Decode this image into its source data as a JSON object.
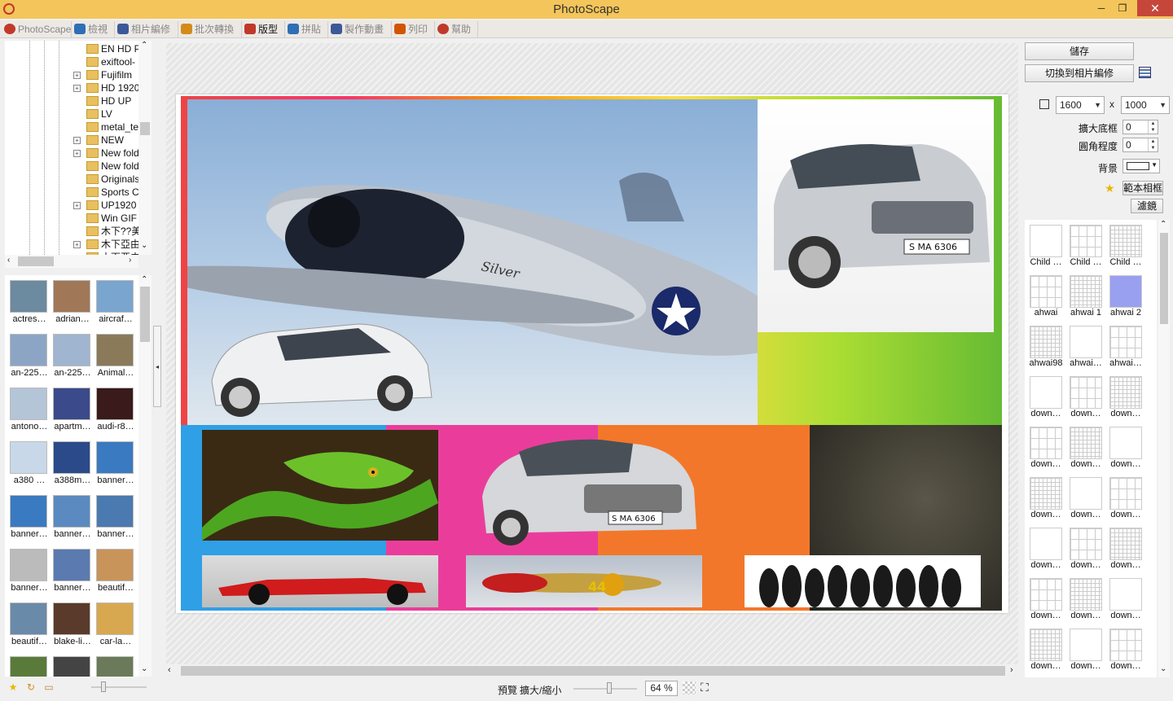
{
  "window": {
    "title": "PhotoScape",
    "close_glyph": "✕",
    "max_glyph": "❐",
    "min_glyph": "─"
  },
  "tabs": [
    {
      "label": "PhotoScape",
      "color": "#c0392b"
    },
    {
      "label": "檢視",
      "color": "#2e6fb5"
    },
    {
      "label": "相片編修",
      "color": "#3b5998"
    },
    {
      "label": "批次轉換",
      "color": "#d48b1a"
    },
    {
      "label": "版型",
      "color": "#c0392b"
    },
    {
      "label": "拼貼",
      "color": "#2e6fb5"
    },
    {
      "label": "製作動畫",
      "color": "#3b5998"
    },
    {
      "label": "列印",
      "color": "#d35400"
    },
    {
      "label": "幫助",
      "color": "#c0392b"
    }
  ],
  "tree": {
    "items": [
      {
        "label": "EN HD P",
        "expander": ""
      },
      {
        "label": "exiftool-",
        "expander": ""
      },
      {
        "label": "Fujifilm",
        "expander": "+"
      },
      {
        "label": "HD 1920",
        "expander": "+"
      },
      {
        "label": "HD UP",
        "expander": ""
      },
      {
        "label": "LV",
        "expander": ""
      },
      {
        "label": "metal_te",
        "expander": ""
      },
      {
        "label": "NEW",
        "expander": "+"
      },
      {
        "label": "New fold",
        "expander": "+"
      },
      {
        "label": "New fold",
        "expander": ""
      },
      {
        "label": "Originals",
        "expander": ""
      },
      {
        "label": "Sports C",
        "expander": ""
      },
      {
        "label": "UP1920",
        "expander": "+"
      },
      {
        "label": "Win GIF",
        "expander": ""
      },
      {
        "label": "木下??美",
        "expander": ""
      },
      {
        "label": "木下亞由",
        "expander": "+"
      },
      {
        "label": "木下亞由",
        "expander": ""
      }
    ]
  },
  "thumbnails": [
    {
      "caption": "actres…",
      "color": "#6c8aa0"
    },
    {
      "caption": "adrian…",
      "color": "#a07858"
    },
    {
      "caption": "aircraf…",
      "color": "#7aa5cf"
    },
    {
      "caption": "an-225…",
      "color": "#8ca5c5"
    },
    {
      "caption": "an-225…",
      "color": "#9fb5d0"
    },
    {
      "caption": "Animal…",
      "color": "#8a7a5a"
    },
    {
      "caption": "antono…",
      "color": "#b5c5d8"
    },
    {
      "caption": "apartm…",
      "color": "#3a4a8a"
    },
    {
      "caption": "audi-r8…",
      "color": "#3a1a1a"
    },
    {
      "caption": "a380 …",
      "color": "#c8d8e8"
    },
    {
      "caption": "a388m…",
      "color": "#2a4a8a"
    },
    {
      "caption": "banner…",
      "color": "#3a7ac0"
    },
    {
      "caption": "banner…",
      "color": "#3a7ac0"
    },
    {
      "caption": "banner…",
      "color": "#5a8ac0"
    },
    {
      "caption": "banner…",
      "color": "#4a7ab0"
    },
    {
      "caption": "banner…",
      "color": "#bbbbbb"
    },
    {
      "caption": "banner…",
      "color": "#5a7ab0"
    },
    {
      "caption": "beautif…",
      "color": "#c8945a"
    },
    {
      "caption": "beautif…",
      "color": "#6a8aaa"
    },
    {
      "caption": "blake-li…",
      "color": "#5a3a2a"
    },
    {
      "caption": "car-la…",
      "color": "#d8a850"
    },
    {
      "caption": "",
      "color": "#5a7a3a"
    },
    {
      "caption": "",
      "color": "#444444"
    },
    {
      "caption": "",
      "color": "#6a7a5a"
    }
  ],
  "right": {
    "save_label": "儲存",
    "switch_label": "切換到相片編修",
    "width": "1600",
    "x_label": "x",
    "height": "1000",
    "expand_border_label": "擴大底框",
    "expand_border_value": "0",
    "round_corner_label": "圓角程度",
    "round_corner_value": "0",
    "bg_label": "背景",
    "template_frame_label": "範本相框",
    "filter_label": "濾鏡"
  },
  "templates": [
    "Child …",
    "Child …",
    "Child …",
    "ahwai",
    "ahwai 1",
    "ahwai 2",
    "ahwai98",
    "ahwai…",
    "ahwai…",
    "down…",
    "down…",
    "down…",
    "down…",
    "down…",
    "down…",
    "down…",
    "down…",
    "down…",
    "down…",
    "down…",
    "down…",
    "down…",
    "down…",
    "down…",
    "down…",
    "down…",
    "down…"
  ],
  "status": {
    "preview_label": "預覽",
    "zoom_label": "擴大/縮小",
    "zoom_value": "64 %"
  },
  "collage_text": {
    "plate_1": "S MA 6306",
    "plate_2": "S MA 6306",
    "plane_name": "Silver",
    "plane_number": "44"
  }
}
